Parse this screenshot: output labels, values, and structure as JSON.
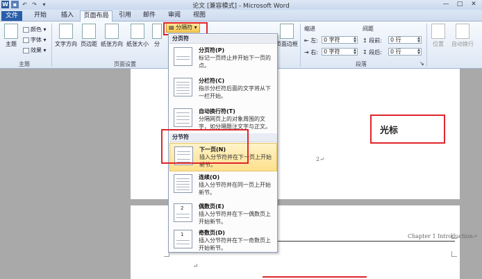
{
  "window": {
    "title": "论文 [兼容模式] - Microsoft Word",
    "controls": [
      "—",
      "□",
      "✕"
    ]
  },
  "tabs": [
    "文件",
    "开始",
    "插入",
    "页面布局",
    "引用",
    "邮件",
    "审阅",
    "视图"
  ],
  "ribbon": {
    "theme_group": {
      "label": "主题",
      "themes_btn": "主题",
      "colors": "颜色",
      "fonts": "字体",
      "effects": "效果"
    },
    "page_setup_group": {
      "label": "页面设置",
      "text_direction": "文字方向",
      "margins": "页边距",
      "orientation": "纸张方向",
      "size": "纸张大小",
      "columns": "分",
      "breaks_button": "分隔符"
    },
    "page_bg": {
      "page_borders": "页面边框"
    },
    "indent": {
      "label": "缩进",
      "left_label": "左:",
      "left_value": "0 字符",
      "right_label": "右:",
      "right_value": "0 字符"
    },
    "spacing": {
      "label": "间距",
      "before_label": "段前:",
      "before_value": "0 行",
      "after_label": "段后:",
      "after_value": "0 行"
    },
    "paragraph_group": {
      "label": "段落"
    },
    "arrange": {
      "position": "位置",
      "wrap": "自动换行"
    }
  },
  "breaks_menu": {
    "page_breaks_header": "分页符",
    "section_breaks_header": "分节符",
    "items": [
      {
        "title": "分页符(P)",
        "desc": "标记一页终止并开始下一页的点。"
      },
      {
        "title": "分栏符(C)",
        "desc": "指示分栏符后面的文字将从下一栏开始。"
      },
      {
        "title": "自动换行符(T)",
        "desc": "分隔网页上的对象周围的文字，如分隔题注文字与正文。"
      },
      {
        "title": "下一页(N)",
        "desc": "插入分节符并在下一页上开始新节。"
      },
      {
        "title": "连续(O)",
        "desc": "插入分节符并在同一页上开始新节。"
      },
      {
        "title": "偶数页(E)",
        "desc": "插入分节符并在下一偶数页上开始新节。"
      },
      {
        "title": "奇数页(D)",
        "desc": "插入分节符并在下一奇数页上开始新节。"
      }
    ]
  },
  "document": {
    "page_number": "2↵",
    "running_header": "Chapter 1 Introduction↵",
    "para_mark": "↵",
    "annotation_label": "光标"
  }
}
